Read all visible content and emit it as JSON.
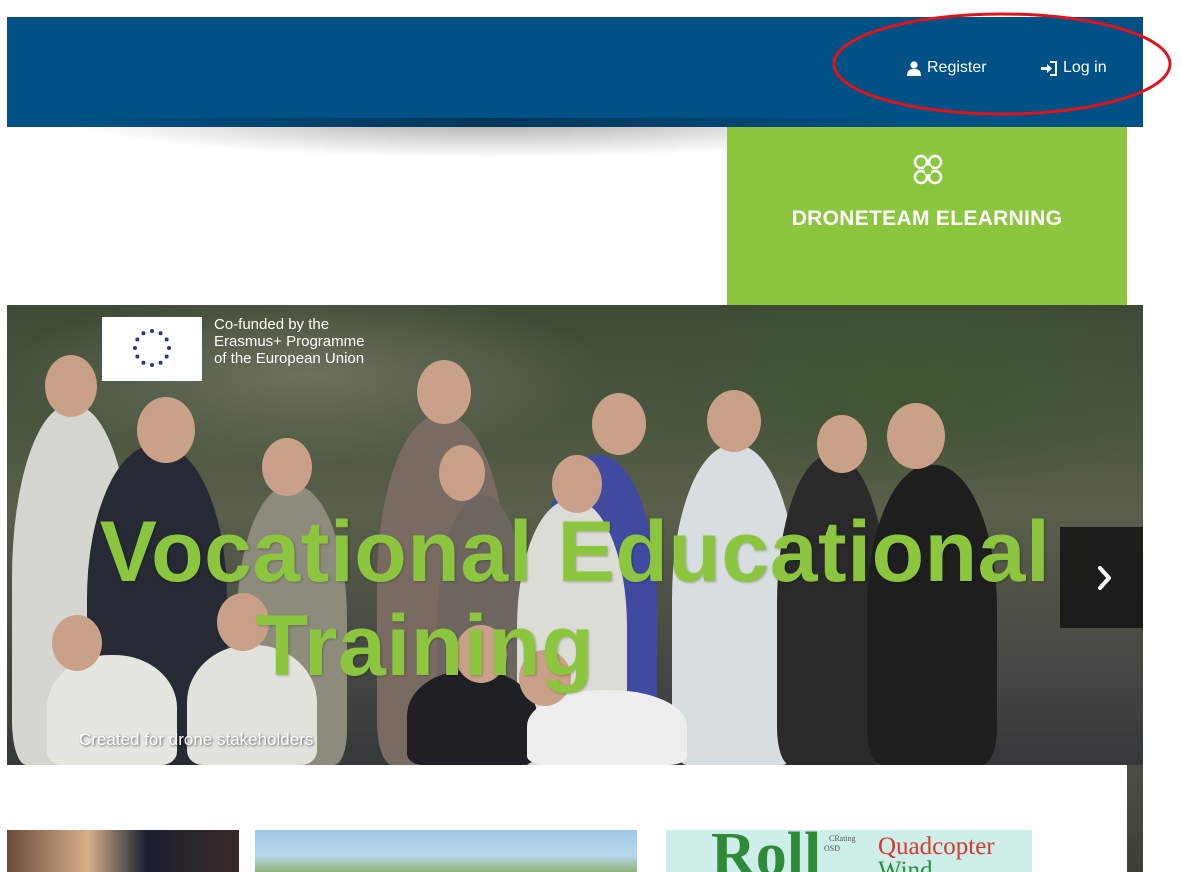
{
  "header": {
    "register_label": "Register",
    "login_label": "Log in",
    "bg_color": "#005186",
    "highlight_color": "#e0141b"
  },
  "brand": {
    "name": "DRONETEAM ELEARNING",
    "bg_color": "#8cc63f"
  },
  "hero": {
    "eu_text_line1": "Co-funded by the",
    "eu_text_line2": "Erasmus+ Programme",
    "eu_text_line3": "of the European Union",
    "title_line1": "Vocational Educational",
    "title_line2": "Training",
    "subtitle": "Created for drone stakeholders",
    "next_icon": "chevron-right-icon",
    "title_color": "#8cc63f"
  },
  "thumbnails": {
    "third_big": "Roll",
    "third_line1": "Quadcopter",
    "third_line2": "Wind",
    "third_small1": "CRating",
    "third_small2": "OSD"
  }
}
